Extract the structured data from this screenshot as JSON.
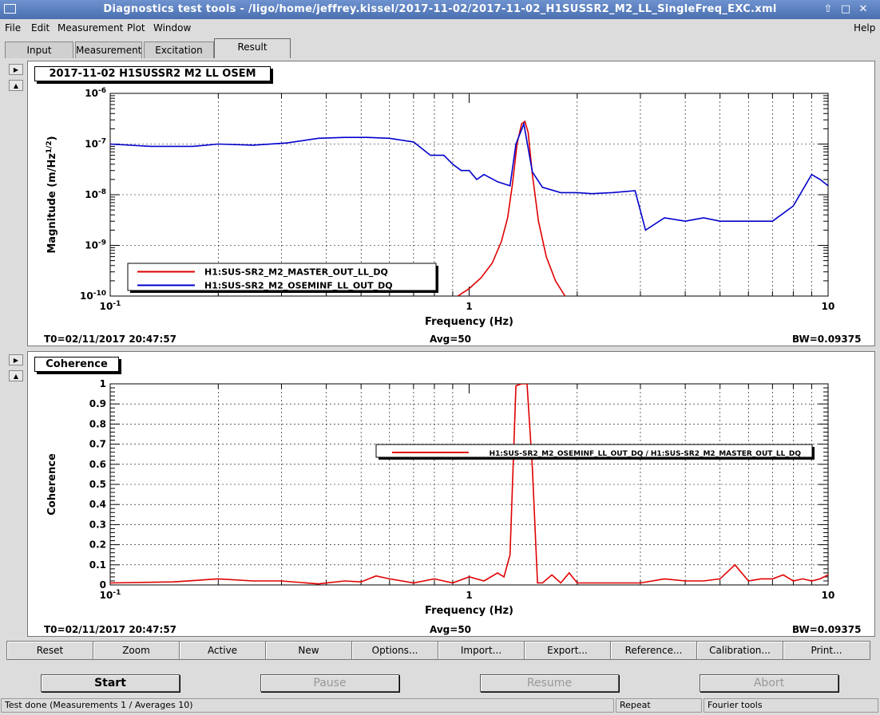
{
  "window": {
    "title": "Diagnostics test tools - /ligo/home/jeffrey.kissel/2017-11-02/2017-11-02_H1SUSSR2_M2_LL_SingleFreq_EXC.xml"
  },
  "menu": {
    "file": "File",
    "edit": "Edit",
    "measurement": "Measurement",
    "plot": "Plot",
    "window": "Window",
    "help": "Help"
  },
  "tabs": [
    "Input",
    "Measurement",
    "Excitation",
    "Result"
  ],
  "active_tab": "Result",
  "colors": {
    "master": "#e00000",
    "oseminf": "#0000cc",
    "grid": "#000000"
  },
  "plot1": {
    "label": "2017-11-02 H1SUSSR2 M2 LL OSEM",
    "info": {
      "t0": "T0=02/11/2017 20:47:57",
      "avg": "Avg=50",
      "bw": "BW=0.09375"
    }
  },
  "plot2": {
    "label": "Coherence",
    "info": {
      "t0": "T0=02/11/2017 20:47:57",
      "avg": "Avg=50",
      "bw": "BW=0.09375"
    }
  },
  "chart_data": [
    {
      "type": "line",
      "title": "2017-11-02 H1SUSSR2 M2 LL OSEM",
      "xlabel": "Frequency (Hz)",
      "ylabel": "Magnitude (m/Hz^1/2)",
      "xscale": "log",
      "yscale": "log",
      "xlim": [
        0.1,
        10
      ],
      "ylim": [
        1e-10,
        1e-06
      ],
      "x_ticks": [
        "10^-1",
        "1",
        "10"
      ],
      "y_ticks": [
        "10^-10",
        "10^-9",
        "10^-8",
        "10^-7",
        "10^-6"
      ],
      "grid": true,
      "legend": "bottom-left",
      "series": [
        {
          "name": "H1:SUS-SR2_M2_MASTER_OUT_LL_DQ",
          "color": "#e00000",
          "x": [
            0.93,
            1.0,
            1.08,
            1.16,
            1.23,
            1.28,
            1.32,
            1.36,
            1.4,
            1.43,
            1.46,
            1.5,
            1.56,
            1.64,
            1.74,
            1.85
          ],
          "y": [
            1e-10,
            1.4e-10,
            2.3e-10,
            4.5e-10,
            1.2e-09,
            3.5e-09,
            1.6e-08,
            1e-07,
            2.5e-07,
            2.8e-07,
            1.7e-07,
            2.5e-08,
            3e-09,
            6e-10,
            2e-10,
            1e-10
          ]
        },
        {
          "name": "H1:SUS-SR2_M2_OSEMINF_LL_OUT_DQ",
          "color": "#0000cc",
          "x": [
            0.1,
            0.13,
            0.17,
            0.2,
            0.25,
            0.31,
            0.38,
            0.45,
            0.52,
            0.6,
            0.7,
            0.78,
            0.85,
            0.9,
            0.95,
            1.0,
            1.05,
            1.1,
            1.2,
            1.3,
            1.35,
            1.42,
            1.5,
            1.6,
            1.8,
            2.0,
            2.2,
            2.5,
            2.9,
            3.1,
            3.5,
            4.0,
            4.5,
            5.0,
            6.0,
            7.0,
            8.0,
            9.0,
            9.5,
            10.0
          ],
          "y": [
            1e-07,
            9e-08,
            9e-08,
            1e-07,
            9.5e-08,
            1.05e-07,
            1.3e-07,
            1.35e-07,
            1.35e-07,
            1.3e-07,
            1.1e-07,
            6e-08,
            6e-08,
            4e-08,
            3e-08,
            3e-08,
            2e-08,
            2.5e-08,
            1.8e-08,
            1.5e-08,
            1e-07,
            2.5e-07,
            2.8e-08,
            1.4e-08,
            1.1e-08,
            1.1e-08,
            1.05e-08,
            1.1e-08,
            1.2e-08,
            2e-09,
            3.5e-09,
            3e-09,
            3.5e-09,
            3e-09,
            3e-09,
            3e-09,
            6e-09,
            2.5e-08,
            2e-08,
            1.5e-08
          ]
        }
      ]
    },
    {
      "type": "line",
      "title": "Coherence",
      "xlabel": "Frequency (Hz)",
      "ylabel": "Coherence",
      "xscale": "log",
      "yscale": "linear",
      "xlim": [
        0.1,
        10
      ],
      "ylim": [
        0,
        1
      ],
      "x_ticks": [
        "10^-1",
        "1",
        "10"
      ],
      "y_ticks": [
        "0",
        "0.1",
        "0.2",
        "0.3",
        "0.4",
        "0.5",
        "0.6",
        "0.7",
        "0.8",
        "0.9",
        "1"
      ],
      "grid": true,
      "legend": "top-right",
      "series": [
        {
          "name": "H1:SUS-SR2_M2_OSEMINF_LL_OUT_DQ / H1:SUS-SR2_M2_MASTER_OUT_LL_DQ",
          "color": "#e00000",
          "x": [
            0.1,
            0.15,
            0.2,
            0.25,
            0.3,
            0.38,
            0.45,
            0.5,
            0.55,
            0.6,
            0.7,
            0.8,
            0.9,
            1.0,
            1.1,
            1.2,
            1.25,
            1.3,
            1.35,
            1.4,
            1.45,
            1.5,
            1.55,
            1.6,
            1.7,
            1.8,
            1.9,
            2.0,
            2.2,
            2.5,
            3.0,
            3.5,
            4.0,
            4.5,
            5.0,
            5.5,
            6.0,
            6.5,
            7.0,
            7.5,
            8.0,
            8.5,
            9.0,
            9.5,
            10.0
          ],
          "y": [
            0.01,
            0.015,
            0.03,
            0.02,
            0.02,
            0.005,
            0.02,
            0.015,
            0.045,
            0.03,
            0.01,
            0.03,
            0.01,
            0.04,
            0.02,
            0.06,
            0.04,
            0.15,
            0.99,
            1.0,
            1.0,
            0.58,
            0.01,
            0.01,
            0.05,
            0.01,
            0.06,
            0.01,
            0.01,
            0.01,
            0.01,
            0.03,
            0.02,
            0.02,
            0.03,
            0.1,
            0.02,
            0.03,
            0.03,
            0.05,
            0.02,
            0.03,
            0.02,
            0.03,
            0.05
          ]
        }
      ]
    }
  ],
  "plot_buttons": [
    "Reset",
    "Zoom",
    "Active",
    "New",
    "Options...",
    "Import...",
    "Export...",
    "Reference...",
    "Calibration...",
    "Print..."
  ],
  "control_buttons": {
    "start": "Start",
    "pause": "Pause",
    "resume": "Resume",
    "abort": "Abort"
  },
  "status": {
    "message": "Test done (Measurements 1 / Averages 10)",
    "mode": "Repeat",
    "tools": "Fourier tools"
  }
}
